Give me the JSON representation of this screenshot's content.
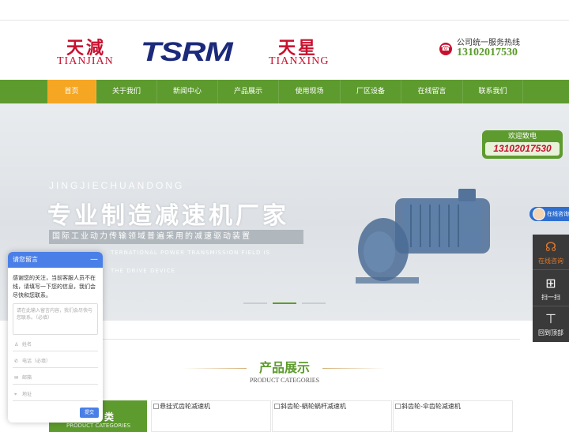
{
  "header": {
    "logo_left_cn": "天減",
    "logo_left_en": "TIANJIAN",
    "logo_center": "TSRM",
    "logo_right_cn": "天星",
    "logo_right_en": "TIANXING",
    "hotline_label": "公司统一服务热线",
    "hotline_number": "13102017530"
  },
  "nav": {
    "items": [
      {
        "label": "首页",
        "active": true
      },
      {
        "label": "关于我们"
      },
      {
        "label": "新闻中心"
      },
      {
        "label": "产品展示"
      },
      {
        "label": "使用现场"
      },
      {
        "label": "厂区设备"
      },
      {
        "label": "在线留言"
      },
      {
        "label": "联系我们"
      }
    ]
  },
  "banner": {
    "pinyin": "JINGJIECHUANDONG",
    "title": "专业制造减速机厂家",
    "subtitle": "国际工业动力传输领域普遍采用的减速驱动装置",
    "en_line1": "TERNATIONAL POWER TRANSMISSION FIELD IS",
    "en_line2": "THE DRIVE DEVICE",
    "slide_count": 3,
    "active_slide": 2
  },
  "welcome": {
    "label": "欢迎致电",
    "number": "13102017530"
  },
  "chat_tab": {
    "label": "在线咨询"
  },
  "side_bar": {
    "items": [
      {
        "label": "在线咨询",
        "icon": "headset-icon"
      },
      {
        "label": "扫一扫",
        "icon": "qrcode-icon"
      },
      {
        "label": "回到顶部",
        "icon": "arrow-up-icon"
      }
    ]
  },
  "products_section": {
    "title": "产品展示",
    "subtitle": "PRODUCT CATEGORIES",
    "category_title": "类",
    "category_sub": "PRODUCT CATEGORIES",
    "items": [
      {
        "alt": "悬挂式齿轮减速机"
      },
      {
        "alt": "斜齿轮-蜗轮蜗杆减速机"
      },
      {
        "alt": "斜齿轮-伞齿轮减速机"
      }
    ]
  },
  "message": {
    "header": "请您留言",
    "minimize": "—",
    "intro": "感谢您的关注，当前客服人员不在线，请填写一下您的信息，我们会尽快和您联系。",
    "textarea_placeholder": "请在此输入留言内容，我们会尽快与您联系。（必填）",
    "fields": [
      {
        "placeholder": "姓名",
        "icon": "user-icon"
      },
      {
        "placeholder": "电话（必填）",
        "icon": "phone-icon"
      },
      {
        "placeholder": "邮箱",
        "icon": "mail-icon"
      },
      {
        "placeholder": "地址",
        "icon": "location-icon"
      }
    ],
    "submit": "提交"
  },
  "colors": {
    "brand_green": "#5e9b2f",
    "brand_red": "#c8102e",
    "nav_active": "#f5a623",
    "logo_blue": "#1b2a7a",
    "chat_blue": "#4a7fe8"
  }
}
